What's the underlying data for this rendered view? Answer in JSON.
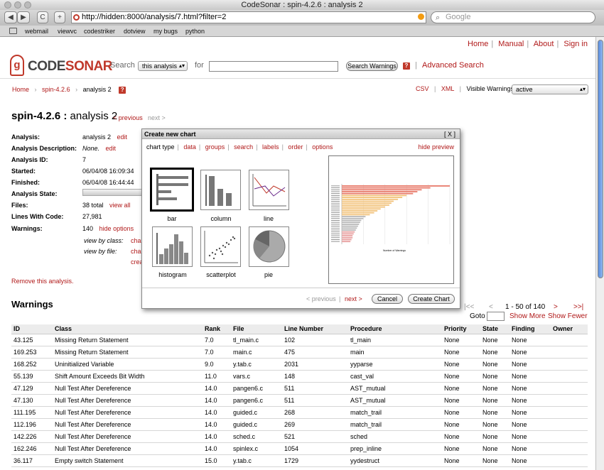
{
  "window": {
    "title": "CodeSonar : spin-4.2.6 : analysis 2"
  },
  "browser": {
    "back_label": "◀",
    "forward_label": "▶",
    "reload_label": "C",
    "add_label": "+",
    "url": "http://hidden:8000/analysis/7.html?filter=2",
    "search_placeholder": "Google",
    "bookmarks": [
      "webmail",
      "viewvc",
      "codestriker",
      "dotview",
      "my bugs",
      "python"
    ]
  },
  "top_links": [
    "Home",
    "Manual",
    "About",
    "Sign in"
  ],
  "logo": {
    "part1": "CODE",
    "part2": "SONAR"
  },
  "search": {
    "label": "Search",
    "scope": "this analysis",
    "for_label": "for",
    "query": "",
    "button": "Search Warnings",
    "help": "?",
    "advanced": "Advanced Search"
  },
  "breadcrumb": {
    "home": "Home",
    "project": "spin-4.2.6",
    "current": "analysis 2",
    "help": "?"
  },
  "export": {
    "csv": "CSV",
    "xml": "XML",
    "visible_label": "Visible Warnings:",
    "visible_value": "active"
  },
  "heading": {
    "project": "spin-4.2.6",
    "sep": ":",
    "analysis": "analysis 2",
    "previous": "< previous",
    "next": "next >"
  },
  "details": {
    "analysis_label": "Analysis:",
    "analysis_value": "analysis 2",
    "analysis_edit": "edit",
    "description_label": "Analysis Description:",
    "description_value": "None.",
    "description_edit": "edit",
    "id_label": "Analysis ID:",
    "id_value": "7",
    "started_label": "Started:",
    "started_value": "06/04/08 16:09:34",
    "finished_label": "Finished:",
    "finished_value": "06/04/08 16:44:44",
    "state_label": "Analysis State:",
    "files_label": "Files:",
    "files_value": "38 total",
    "files_link": "view all",
    "lines_label": "Lines With Code:",
    "lines_value": "27,981",
    "warnings_label": "Warnings:",
    "warnings_value": "140",
    "warnings_link": "hide options",
    "by_class_label": "view by class:",
    "by_class_link": "cha",
    "by_file_label": "view by file:",
    "by_file_link": "cha",
    "create_link": "crea"
  },
  "remove_link": "Remove this analysis.",
  "warnings_heading": "Warnings",
  "pager": {
    "first": "|<<",
    "prev": "<",
    "range": "1 - 50 of 140",
    "next": ">",
    "last": ">>|",
    "goto_label": "Goto",
    "show_more": "Show More",
    "show_fewer": "Show Fewer"
  },
  "modal": {
    "title": "Create new chart",
    "close": "[ X ]",
    "tabs": [
      "chart type",
      "data",
      "groups",
      "search",
      "labels",
      "order",
      "options"
    ],
    "hide_preview": "hide preview",
    "chart_types": [
      "bar",
      "column",
      "line",
      "histogram",
      "scatterplot",
      "pie"
    ],
    "previous": "< previous",
    "next": "next >",
    "cancel": "Cancel",
    "create": "Create Chart",
    "preview_axis_label": "Number of Warnings"
  },
  "preview_chart": {
    "bars": [
      1.0,
      0.82,
      0.74,
      0.7,
      0.66,
      0.6,
      0.56,
      0.52,
      0.48,
      0.46,
      0.44,
      0.4,
      0.36,
      0.33,
      0.3,
      0.26,
      0.22,
      0.2,
      0.18,
      0.17,
      0.16,
      0.15,
      0.14,
      0.13,
      0.12,
      0.11,
      0.1,
      0.1,
      0.09,
      0.08
    ]
  },
  "table": {
    "headers": [
      "ID",
      "Class",
      "Rank",
      "File",
      "Line Number",
      "Procedure",
      "Priority",
      "State",
      "Finding",
      "Owner"
    ],
    "rows": [
      [
        "43.125",
        "Missing Return Statement",
        "7.0",
        "tl_main.c",
        "102",
        "tl_main",
        "None",
        "None",
        "None",
        ""
      ],
      [
        "169.253",
        "Missing Return Statement",
        "7.0",
        "main.c",
        "475",
        "main",
        "None",
        "None",
        "None",
        ""
      ],
      [
        "168.252",
        "Uninitialized Variable",
        "9.0",
        "y.tab.c",
        "2031",
        "yyparse",
        "None",
        "None",
        "None",
        ""
      ],
      [
        "55.139",
        "Shift Amount Exceeds Bit Width",
        "11.0",
        "vars.c",
        "148",
        "cast_val",
        "None",
        "None",
        "None",
        ""
      ],
      [
        "47.129",
        "Null Test After Dereference",
        "14.0",
        "pangen6.c",
        "511",
        "AST_mutual",
        "None",
        "None",
        "None",
        ""
      ],
      [
        "47.130",
        "Null Test After Dereference",
        "14.0",
        "pangen6.c",
        "511",
        "AST_mutual",
        "None",
        "None",
        "None",
        ""
      ],
      [
        "111.195",
        "Null Test After Dereference",
        "14.0",
        "guided.c",
        "268",
        "match_trail",
        "None",
        "None",
        "None",
        ""
      ],
      [
        "112.196",
        "Null Test After Dereference",
        "14.0",
        "guided.c",
        "269",
        "match_trail",
        "None",
        "None",
        "None",
        ""
      ],
      [
        "142.226",
        "Null Test After Dereference",
        "14.0",
        "sched.c",
        "521",
        "sched",
        "None",
        "None",
        "None",
        ""
      ],
      [
        "162.246",
        "Null Test After Dereference",
        "14.0",
        "spinlex.c",
        "1054",
        "prep_inline",
        "None",
        "None",
        "None",
        ""
      ],
      [
        "36.117",
        "Empty switch Statement",
        "15.0",
        "y.tab.c",
        "1729",
        "yydestruct",
        "None",
        "None",
        "None",
        ""
      ]
    ]
  }
}
